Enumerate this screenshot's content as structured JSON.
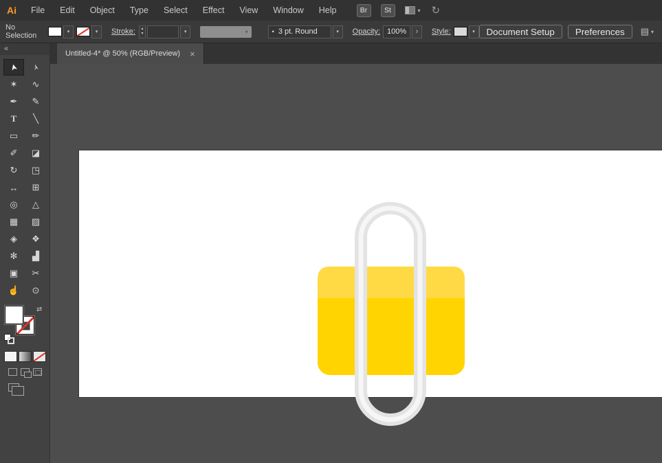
{
  "menubar": {
    "logo": "Ai",
    "items": [
      "File",
      "Edit",
      "Object",
      "Type",
      "Select",
      "Effect",
      "View",
      "Window",
      "Help"
    ],
    "bridge_badge": "Br",
    "stock_badge": "St"
  },
  "controlbar": {
    "selection_status": "No Selection",
    "stroke_label": "Stroke:",
    "stroke_value": "",
    "brush_name": "3 pt. Round",
    "opacity_label": "Opacity:",
    "opacity_value": "100%",
    "style_label": "Style:",
    "document_setup_button": "Document Setup",
    "preferences_button": "Preferences"
  },
  "tabbar": {
    "active_tab": "Untitled-4* @ 50% (RGB/Preview)"
  },
  "toolbar": {
    "tools": [
      {
        "name": "selection-tool",
        "glyph": "➤",
        "selected": true
      },
      {
        "name": "direct-selection-tool",
        "glyph": "➢"
      },
      {
        "name": "magic-wand-tool",
        "glyph": "✶"
      },
      {
        "name": "lasso-tool",
        "glyph": "∿"
      },
      {
        "name": "pen-tool",
        "glyph": "✒"
      },
      {
        "name": "curvature-tool",
        "glyph": "✎"
      },
      {
        "name": "type-tool",
        "glyph": "T"
      },
      {
        "name": "line-segment-tool",
        "glyph": "╲"
      },
      {
        "name": "rectangle-tool",
        "glyph": "▭"
      },
      {
        "name": "paintbrush-tool",
        "glyph": "✏"
      },
      {
        "name": "shaper-tool",
        "glyph": "✐"
      },
      {
        "name": "eraser-tool",
        "glyph": "◪"
      },
      {
        "name": "rotate-tool",
        "glyph": "↻"
      },
      {
        "name": "scale-tool",
        "glyph": "◳"
      },
      {
        "name": "width-tool",
        "glyph": "↔"
      },
      {
        "name": "free-transform-tool",
        "glyph": "⊞"
      },
      {
        "name": "shape-builder-tool",
        "glyph": "◎"
      },
      {
        "name": "perspective-grid-tool",
        "glyph": "△"
      },
      {
        "name": "mesh-tool",
        "glyph": "▦"
      },
      {
        "name": "gradient-tool",
        "glyph": "▨"
      },
      {
        "name": "eyedropper-tool",
        "glyph": "◈"
      },
      {
        "name": "blend-tool",
        "glyph": "❖"
      },
      {
        "name": "symbol-sprayer-tool",
        "glyph": "✻"
      },
      {
        "name": "column-graph-tool",
        "glyph": "▟"
      },
      {
        "name": "artboard-tool",
        "glyph": "▣"
      },
      {
        "name": "slice-tool",
        "glyph": "✂"
      },
      {
        "name": "hand-tool",
        "glyph": "☝"
      },
      {
        "name": "zoom-tool",
        "glyph": "⊙"
      }
    ]
  },
  "artwork": {
    "lock_body_color": "#FFD400",
    "lock_body_top_color": "#FFDA45",
    "shackle_color": "#E3E3E3",
    "shackle_highlight_color": "#F6F6F6"
  },
  "icons": {
    "chevron_down": "▾",
    "chevron_right": "›",
    "close": "×",
    "swap": "⇄",
    "collapse": "«",
    "sync": "↻",
    "stepper_up": "▴",
    "stepper_down": "▾",
    "bullet": "•",
    "align": "▤"
  }
}
